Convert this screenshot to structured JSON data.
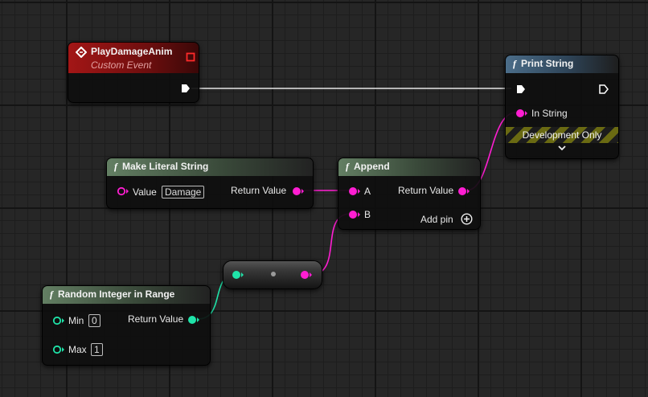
{
  "colors": {
    "string_pin": "#ff1ed2",
    "integer_pin": "#1fe4a9",
    "exec_wire": "#e6e6e6"
  },
  "nodes": {
    "event": {
      "title": "PlayDamageAnim",
      "subtitle": "Custom Event",
      "icon": "event-diamond-icon"
    },
    "print_string": {
      "title": "Print String",
      "func_glyph": "f",
      "in_string_label": "In String",
      "dev_only_label": "Development Only",
      "expand_glyph": "⌄"
    },
    "make_literal_string": {
      "title": "Make Literal String",
      "func_glyph": "f",
      "value_label": "Value",
      "value": "Damage",
      "return_label": "Return Value"
    },
    "append": {
      "title": "Append",
      "func_glyph": "f",
      "a_label": "A",
      "b_label": "B",
      "return_label": "Return Value",
      "add_pin_label": "Add pin",
      "add_pin_icon": "plus-circle-icon"
    },
    "random_int": {
      "title": "Random Integer in Range",
      "func_glyph": "f",
      "min_label": "Min",
      "min_value": "0",
      "max_label": "Max",
      "max_value": "1",
      "return_label": "Return Value"
    },
    "conversion": {
      "icon": "conversion-dot-icon"
    }
  }
}
